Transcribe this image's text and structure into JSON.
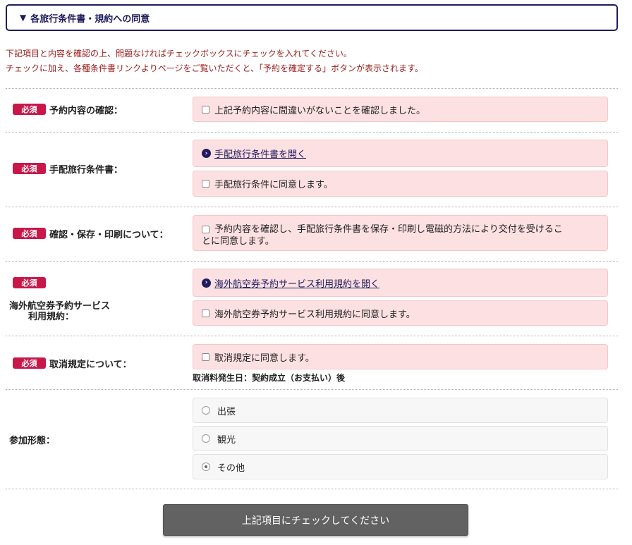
{
  "header": {
    "title": "各旅行条件書・規約への同意"
  },
  "notices": [
    "下記項目と内容を確認の上、問題なければチェックボックスにチェックを入れてください。",
    "チェックに加え、各種条件書リンクよりページをご覧いただくと、「予約を確定する」ボタンが表示されます。"
  ],
  "required_badge": "必須",
  "rows": {
    "booking_confirm": {
      "label": "予約内容の確認：",
      "checkbox_label": "上記予約内容に間違いがないことを確認しました。"
    },
    "travel_conditions": {
      "label": "手配旅行条件書：",
      "link_label": "手配旅行条件書を開く",
      "checkbox_label": "手配旅行条件に同意します。"
    },
    "confirm_save_print": {
      "label": "確認・保存・印刷について：",
      "checkbox_label_line1": "予約内容を確認し、手配旅行条件書を保存・印刷し電磁的方法により交付を受けるこ",
      "checkbox_label_line2": "とに同意します。"
    },
    "air_ticket_terms": {
      "label_line1": "海外航空券予約サービス",
      "label_line2": "利用規約：",
      "link_label": "海外航空券予約サービス利用規約を開く",
      "checkbox_label": "海外航空券予約サービス利用規約に同意します。"
    },
    "cancellation": {
      "label": "取消規定について：",
      "checkbox_label": "取消規定に同意します。",
      "note": "取消料発生日：契約成立（お支払い）後"
    },
    "participation": {
      "label": "参加形態：",
      "options": [
        "出張",
        "観光",
        "その他"
      ],
      "selected": "その他"
    }
  },
  "submit": {
    "label": "上記項目にチェックしてください"
  }
}
